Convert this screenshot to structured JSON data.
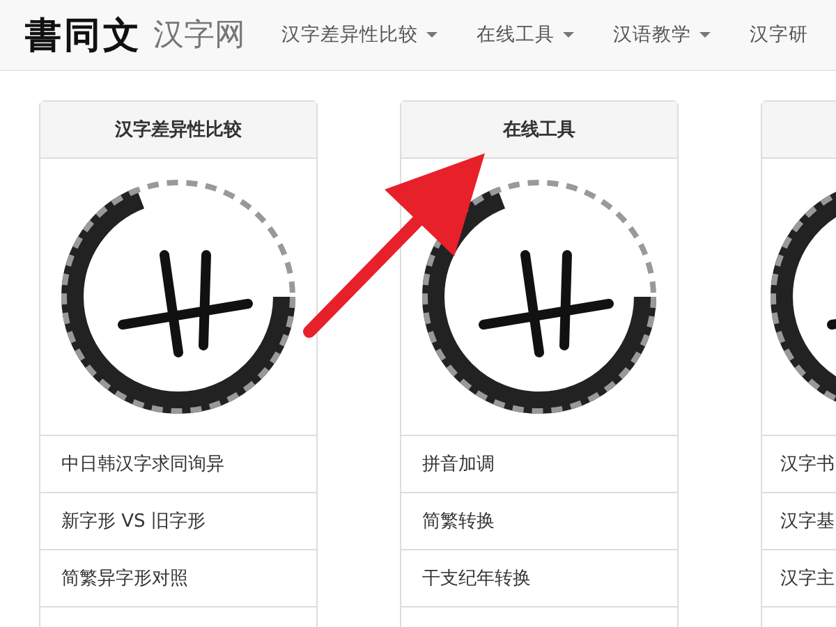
{
  "navbar": {
    "logo_calligraphy": "書同文",
    "site_name": "汉字网",
    "items": [
      {
        "label": "汉字差异性比较",
        "dropdown": true
      },
      {
        "label": "在线工具",
        "dropdown": true
      },
      {
        "label": "汉语教学",
        "dropdown": true
      },
      {
        "label": "汉字研",
        "dropdown": false
      }
    ]
  },
  "cards": [
    {
      "title": "汉字差异性比较",
      "rows": [
        "中日韩汉字求同询异",
        "新字形 VS 旧字形",
        "简繁异字形对照"
      ]
    },
    {
      "title": "在线工具",
      "rows": [
        "拼音加调",
        "简繁转换",
        "干支纪年转换"
      ]
    },
    {
      "rows": [
        "汉字书",
        "汉字基",
        "汉字主"
      ]
    }
  ],
  "annotation": {
    "kind": "arrow"
  }
}
